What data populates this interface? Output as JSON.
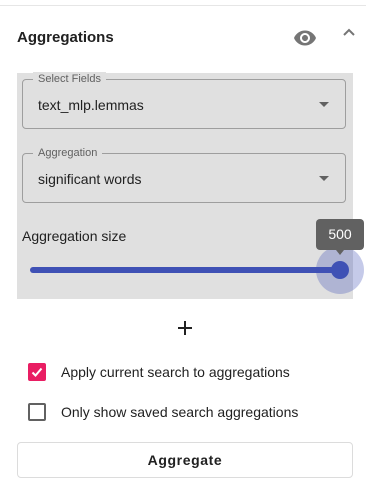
{
  "header": {
    "title": "Aggregations",
    "visibility_icon": "eye-icon",
    "collapse_icon": "chevron-up-icon"
  },
  "fields": {
    "select_fields": {
      "label": "Select Fields",
      "value": "text_mlp.lemmas"
    },
    "aggregation": {
      "label": "Aggregation",
      "value": "significant words"
    }
  },
  "size": {
    "label": "Aggregation size",
    "value": "500",
    "level_percent": 100
  },
  "add_icon": "plus-icon",
  "options": {
    "apply_current": {
      "label": "Apply current search to aggregations",
      "checked": true
    },
    "only_saved": {
      "label": "Only show saved search aggregations",
      "checked": false
    }
  },
  "actions": {
    "aggregate_label": "Aggregate"
  },
  "colors": {
    "accent": "#3f51b5",
    "checkbox": "#e91e63",
    "panel": "#e0e0e0",
    "tooltip": "#616161"
  }
}
